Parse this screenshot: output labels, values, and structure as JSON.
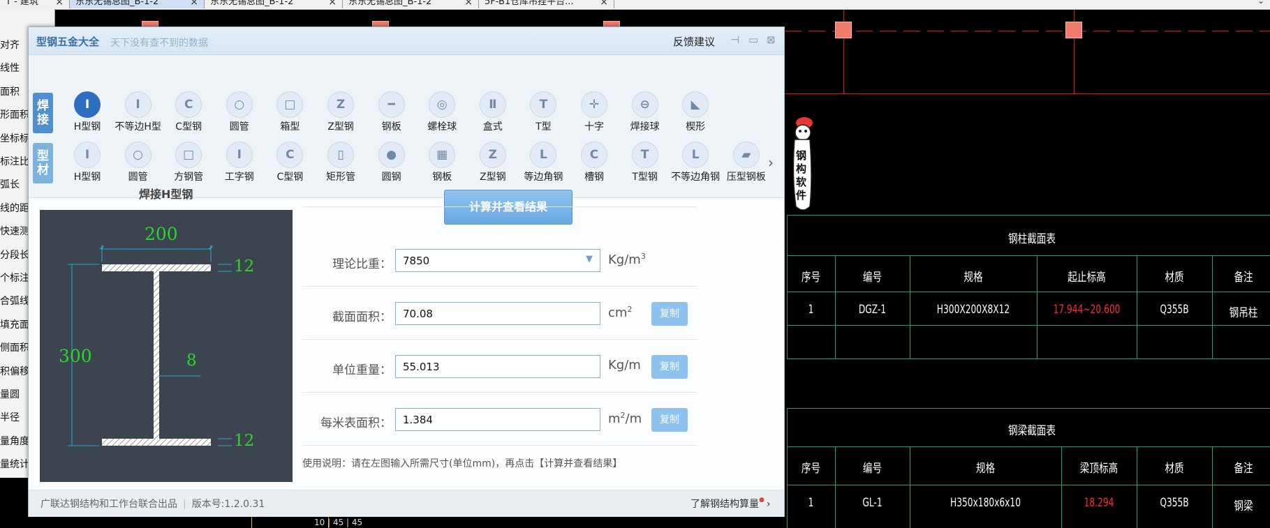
{
  "tabs": [
    {
      "label": "T - 建筑"
    },
    {
      "label": "东东无锡总图_B-1-2"
    },
    {
      "label": "东东无锡总图_B-1-2"
    },
    {
      "label": "东东无锡总图_B-1-2"
    },
    {
      "label": "5F-B1仓库吊挂平台..."
    }
  ],
  "left_tools": [
    "对齐",
    "线性",
    "面积",
    "形面积",
    "坐标标注",
    "标注比",
    "弧长",
    "线的距",
    "快速测量",
    "分段长",
    "个标注",
    "合弧线",
    "填充面",
    "侧面积",
    "积偏移",
    "量圆",
    "半径",
    "量角度",
    "量统计"
  ],
  "dialog": {
    "title": "型钢五金大全",
    "subtitle": "天下没有查不到的数据",
    "feedback": "反馈建议",
    "categories": {
      "weld": "焊接",
      "profile": "型材"
    },
    "weld_items": [
      {
        "label": "H型钢",
        "icon": "h-beam-icon",
        "glyph": "I"
      },
      {
        "label": "不等边H型",
        "icon": "unequal-h-beam-icon",
        "glyph": "I"
      },
      {
        "label": "C型钢",
        "icon": "c-channel-icon",
        "glyph": "C"
      },
      {
        "label": "圆管",
        "icon": "round-tube-icon",
        "glyph": "○"
      },
      {
        "label": "箱型",
        "icon": "box-section-icon",
        "glyph": "□"
      },
      {
        "label": "Z型钢",
        "icon": "z-section-icon",
        "glyph": "Z"
      },
      {
        "label": "钢板",
        "icon": "steel-plate-icon",
        "glyph": "━"
      },
      {
        "label": "螺栓球",
        "icon": "bolt-ball-icon",
        "glyph": "◎"
      },
      {
        "label": "盒式",
        "icon": "box-type-icon",
        "glyph": "Ⅱ"
      },
      {
        "label": "T型",
        "icon": "t-section-icon",
        "glyph": "T"
      },
      {
        "label": "十字",
        "icon": "cross-section-icon",
        "glyph": "✛"
      },
      {
        "label": "焊接球",
        "icon": "welded-ball-icon",
        "glyph": "⊖"
      },
      {
        "label": "楔形",
        "icon": "wedge-icon",
        "glyph": "◣"
      }
    ],
    "profile_items": [
      {
        "label": "H型钢",
        "icon": "h-beam-icon",
        "glyph": "I"
      },
      {
        "label": "圆管",
        "icon": "round-tube-icon",
        "glyph": "○"
      },
      {
        "label": "方钢管",
        "icon": "square-tube-icon",
        "glyph": "□"
      },
      {
        "label": "工字钢",
        "icon": "i-beam-icon",
        "glyph": "I"
      },
      {
        "label": "C型钢",
        "icon": "c-channel-icon",
        "glyph": "C"
      },
      {
        "label": "矩形管",
        "icon": "rect-tube-icon",
        "glyph": "▯"
      },
      {
        "label": "圆钢",
        "icon": "round-bar-icon",
        "glyph": "●"
      },
      {
        "label": "钢板",
        "icon": "checker-plate-icon",
        "glyph": "▦"
      },
      {
        "label": "Z型钢",
        "icon": "z-section-icon",
        "glyph": "Z"
      },
      {
        "label": "等边角钢",
        "icon": "equal-angle-icon",
        "glyph": "L"
      },
      {
        "label": "槽钢",
        "icon": "channel-icon",
        "glyph": "C"
      },
      {
        "label": "T型钢",
        "icon": "t-beam-icon",
        "glyph": "T"
      },
      {
        "label": "不等边角钢",
        "icon": "unequal-angle-icon",
        "glyph": "L"
      },
      {
        "label": "压型钢板",
        "icon": "deck-plate-icon",
        "glyph": "▰"
      }
    ],
    "section_title": "焊接H型钢",
    "dims": {
      "width": "200",
      "height": "300",
      "flange_top": "12",
      "flange_bottom": "12",
      "web": "8"
    },
    "calc_button": "计算并查看结果",
    "fields": [
      {
        "label": "理论比重：",
        "value": "7850",
        "unit": "Kg/m",
        "sup": "3",
        "copy": ""
      },
      {
        "label": "截面面积：",
        "value": "70.08",
        "unit": "cm",
        "sup": "2",
        "copy": "复制"
      },
      {
        "label": "单位重量：",
        "value": "55.013",
        "unit": "Kg/m",
        "sup": "",
        "copy": "复制"
      },
      {
        "label": "每米表面积：",
        "value": "1.384",
        "unit": "m",
        "sup": "2",
        "unit_suffix": "/m",
        "copy": "复制"
      }
    ],
    "usage": "使用说明：请在左图输入所需尺寸(单位mm)，再点击【计算并查看结果】",
    "footer_left": "广联达钢结构和工作台联合出品",
    "version": "版本号:1.2.0.31",
    "footer_right": "了解钢结构算量"
  },
  "mascot_text": "钢构软件",
  "tables": [
    {
      "title": "钢柱截面表",
      "headers": [
        "序号",
        "编号",
        "规格",
        "起止标高",
        "材质",
        "备注"
      ],
      "rows": [
        [
          "1",
          "DGZ-1",
          "H300X200X8X12",
          "17.944~20.600",
          "Q355B",
          "钢吊柱"
        ]
      ]
    },
    {
      "title": "钢梁截面表",
      "headers": [
        "序号",
        "编号",
        "规格",
        "梁顶标高",
        "材质",
        "备注"
      ],
      "rows": [
        [
          "1",
          "GL-1",
          "H350x180x6x10",
          "18.294",
          "Q355B",
          "钢梁"
        ]
      ]
    }
  ],
  "bottom_dims": "10 | 45 | 45",
  "colors": {
    "accent": "#2d6ec0",
    "cad_red": "#e0141d",
    "table_green": "#1fa06c",
    "dim_green": "#2bd52b"
  }
}
